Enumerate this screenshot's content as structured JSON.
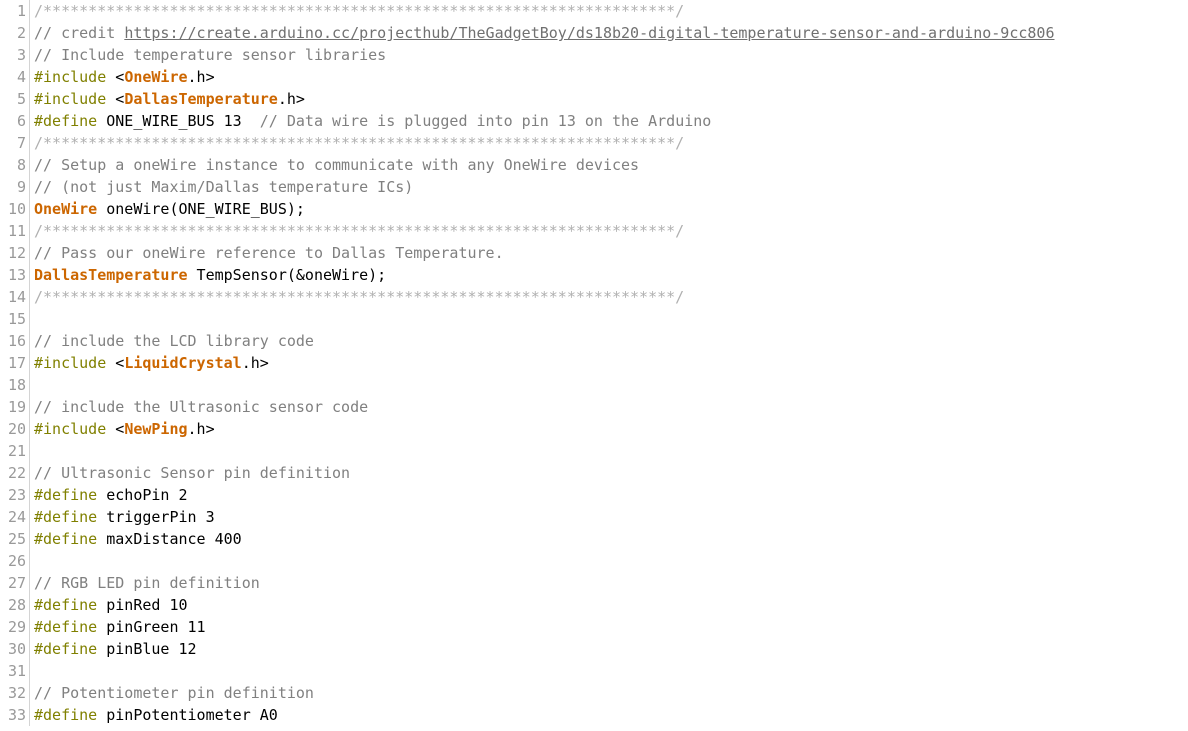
{
  "editor": {
    "name": "code-editor",
    "language": "arduino-cpp",
    "background_color": "#ffffff",
    "gutter_color": "#999999",
    "colors": {
      "comment": "#808080",
      "comment_separator": "#b0b0b0",
      "preprocessor": "#808000",
      "type_name": "#cc6600",
      "plain": "#000000",
      "link": "#707070"
    },
    "first_line_number": 1,
    "last_line_number": 33,
    "total_visible_lines": 33
  },
  "lines": [
    {
      "num": "1",
      "tokens": [
        {
          "cls": "t-cmt-sep",
          "text": "/**********************************************************************/"
        }
      ]
    },
    {
      "num": "2",
      "tokens": [
        {
          "cls": "t-cmt",
          "text": "// credit "
        },
        {
          "cls": "t-link",
          "text": "https://create.arduino.cc/projecthub/TheGadgetBoy/ds18b20-digital-temperature-sensor-and-arduino-9cc806"
        }
      ]
    },
    {
      "num": "3",
      "tokens": [
        {
          "cls": "t-cmt",
          "text": "// Include temperature sensor libraries"
        }
      ]
    },
    {
      "num": "4",
      "tokens": [
        {
          "cls": "t-pre",
          "text": "#include"
        },
        {
          "cls": "t-plain",
          "text": " <"
        },
        {
          "cls": "t-type",
          "text": "OneWire"
        },
        {
          "cls": "t-plain",
          "text": ".h>"
        }
      ]
    },
    {
      "num": "5",
      "tokens": [
        {
          "cls": "t-pre",
          "text": "#include"
        },
        {
          "cls": "t-plain",
          "text": " <"
        },
        {
          "cls": "t-type",
          "text": "DallasTemperature"
        },
        {
          "cls": "t-plain",
          "text": ".h>"
        }
      ]
    },
    {
      "num": "6",
      "tokens": [
        {
          "cls": "t-pre",
          "text": "#define"
        },
        {
          "cls": "t-plain",
          "text": " ONE_WIRE_BUS 13  "
        },
        {
          "cls": "t-cmt",
          "text": "// Data wire is plugged into pin 13 on the Arduino"
        }
      ]
    },
    {
      "num": "7",
      "tokens": [
        {
          "cls": "t-cmt-sep",
          "text": "/**********************************************************************/"
        }
      ]
    },
    {
      "num": "8",
      "tokens": [
        {
          "cls": "t-cmt",
          "text": "// Setup a oneWire instance to communicate with any OneWire devices"
        }
      ]
    },
    {
      "num": "9",
      "tokens": [
        {
          "cls": "t-cmt",
          "text": "// (not just Maxim/Dallas temperature ICs)"
        }
      ]
    },
    {
      "num": "10",
      "tokens": [
        {
          "cls": "t-type",
          "text": "OneWire"
        },
        {
          "cls": "t-plain",
          "text": " oneWire(ONE_WIRE_BUS);"
        }
      ]
    },
    {
      "num": "11",
      "tokens": [
        {
          "cls": "t-cmt-sep",
          "text": "/**********************************************************************/"
        }
      ]
    },
    {
      "num": "12",
      "tokens": [
        {
          "cls": "t-cmt",
          "text": "// Pass our oneWire reference to Dallas Temperature."
        }
      ]
    },
    {
      "num": "13",
      "tokens": [
        {
          "cls": "t-type",
          "text": "DallasTemperature"
        },
        {
          "cls": "t-plain",
          "text": " TempSensor(&oneWire);"
        }
      ]
    },
    {
      "num": "14",
      "tokens": [
        {
          "cls": "t-cmt-sep",
          "text": "/**********************************************************************/"
        }
      ]
    },
    {
      "num": "15",
      "tokens": []
    },
    {
      "num": "16",
      "tokens": [
        {
          "cls": "t-cmt",
          "text": "// include the LCD library code"
        }
      ]
    },
    {
      "num": "17",
      "tokens": [
        {
          "cls": "t-pre",
          "text": "#include"
        },
        {
          "cls": "t-plain",
          "text": " <"
        },
        {
          "cls": "t-type",
          "text": "LiquidCrystal"
        },
        {
          "cls": "t-plain",
          "text": ".h>"
        }
      ]
    },
    {
      "num": "18",
      "tokens": []
    },
    {
      "num": "19",
      "tokens": [
        {
          "cls": "t-cmt",
          "text": "// include the Ultrasonic sensor code"
        }
      ]
    },
    {
      "num": "20",
      "tokens": [
        {
          "cls": "t-pre",
          "text": "#include"
        },
        {
          "cls": "t-plain",
          "text": " <"
        },
        {
          "cls": "t-type",
          "text": "NewPing"
        },
        {
          "cls": "t-plain",
          "text": ".h>"
        }
      ]
    },
    {
      "num": "21",
      "tokens": []
    },
    {
      "num": "22",
      "tokens": [
        {
          "cls": "t-cmt",
          "text": "// Ultrasonic Sensor pin definition"
        }
      ]
    },
    {
      "num": "23",
      "tokens": [
        {
          "cls": "t-pre",
          "text": "#define"
        },
        {
          "cls": "t-plain",
          "text": " echoPin 2"
        }
      ]
    },
    {
      "num": "24",
      "tokens": [
        {
          "cls": "t-pre",
          "text": "#define"
        },
        {
          "cls": "t-plain",
          "text": " triggerPin 3"
        }
      ]
    },
    {
      "num": "25",
      "tokens": [
        {
          "cls": "t-pre",
          "text": "#define"
        },
        {
          "cls": "t-plain",
          "text": " maxDistance 400"
        }
      ]
    },
    {
      "num": "26",
      "tokens": []
    },
    {
      "num": "27",
      "tokens": [
        {
          "cls": "t-cmt",
          "text": "// RGB LED pin definition"
        }
      ]
    },
    {
      "num": "28",
      "tokens": [
        {
          "cls": "t-pre",
          "text": "#define"
        },
        {
          "cls": "t-plain",
          "text": " pinRed 10"
        }
      ]
    },
    {
      "num": "29",
      "tokens": [
        {
          "cls": "t-pre",
          "text": "#define"
        },
        {
          "cls": "t-plain",
          "text": " pinGreen 11"
        }
      ]
    },
    {
      "num": "30",
      "tokens": [
        {
          "cls": "t-pre",
          "text": "#define"
        },
        {
          "cls": "t-plain",
          "text": " pinBlue 12"
        }
      ]
    },
    {
      "num": "31",
      "tokens": []
    },
    {
      "num": "32",
      "tokens": [
        {
          "cls": "t-cmt",
          "text": "// Potentiometer pin definition"
        }
      ]
    },
    {
      "num": "33",
      "tokens": [
        {
          "cls": "t-pre",
          "text": "#define"
        },
        {
          "cls": "t-plain",
          "text": " pinPotentiometer A0"
        }
      ]
    }
  ]
}
